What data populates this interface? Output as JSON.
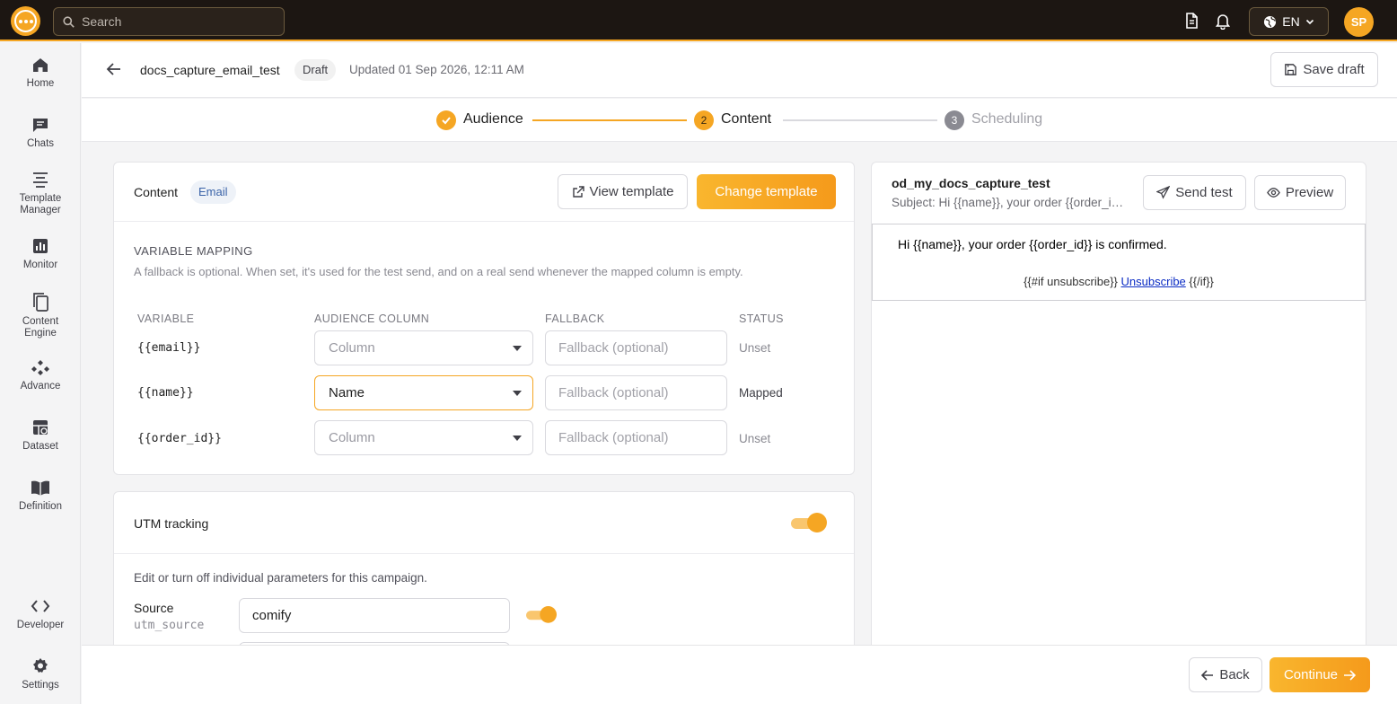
{
  "topbar": {
    "search_placeholder": "Search",
    "lang": "EN",
    "avatar_initials": "SP"
  },
  "sidebar": {
    "items": [
      {
        "label": "Home",
        "icon": "home-icon"
      },
      {
        "label": "Chats",
        "icon": "chat-icon"
      },
      {
        "label": "Template Manager",
        "icon": "template-icon"
      },
      {
        "label": "Monitor",
        "icon": "monitor-icon"
      },
      {
        "label": "Content Engine",
        "icon": "content-engine-icon"
      },
      {
        "label": "Advance",
        "icon": "advance-icon"
      },
      {
        "label": "Dataset",
        "icon": "dataset-icon"
      },
      {
        "label": "Definition",
        "icon": "definition-icon"
      },
      {
        "label": "Developer",
        "icon": "code-icon"
      },
      {
        "label": "Settings",
        "icon": "gear-icon"
      }
    ]
  },
  "header": {
    "campaign_name": "docs_capture_email_test",
    "badge": "Draft",
    "updated": "Updated 01 Sep 2026, 12:11 AM",
    "save_draft": "Save draft"
  },
  "stepper": {
    "steps": [
      {
        "num": "",
        "label": "Audience",
        "state": "done"
      },
      {
        "num": "2",
        "label": "Content",
        "state": "active"
      },
      {
        "num": "3",
        "label": "Scheduling",
        "state": "pending"
      }
    ]
  },
  "content_card": {
    "title": "Content",
    "badge": "Email",
    "view_template": "View template",
    "change_template": "Change template",
    "mapping_title": "VARIABLE MAPPING",
    "mapping_desc": "A fallback is optional. When set, it's used for the test send, and on a real send whenever the mapped column is empty.",
    "columns": {
      "variable": "VARIABLE",
      "audience_column": "AUDIENCE COLUMN",
      "fallback": "FALLBACK",
      "status": "STATUS"
    },
    "rows": [
      {
        "variable": "{{email}}",
        "column": "Column",
        "column_selected": false,
        "fallback_placeholder": "Fallback (optional)",
        "status": "Unset"
      },
      {
        "variable": "{{name}}",
        "column": "Name",
        "column_selected": true,
        "fallback_placeholder": "Fallback (optional)",
        "status": "Mapped"
      },
      {
        "variable": "{{order_id}}",
        "column": "Column",
        "column_selected": false,
        "fallback_placeholder": "Fallback (optional)",
        "status": "Unset"
      }
    ]
  },
  "utm_card": {
    "title": "UTM tracking",
    "enabled": true,
    "desc": "Edit or turn off individual parameters for this campaign.",
    "source_label": "Source",
    "source_key": "utm_source",
    "source_value": "comify",
    "source_enabled": true
  },
  "preview": {
    "template_name": "od_my_docs_capture_test",
    "subject": "Subject: Hi {{name}}, your order {{order_id}} is confirmed.",
    "send_test": "Send test",
    "preview": "Preview",
    "body_text": "Hi {{name}}, your order {{order_id}} is confirmed.",
    "footer_prefix": "{{#if unsubscribe}}",
    "footer_link": "Unsubscribe",
    "footer_suffix": "{{/if}}"
  },
  "footer": {
    "back": "Back",
    "continue": "Continue"
  },
  "colors": {
    "accent": "#f5a623",
    "topbar": "#1c1612",
    "mapped": "#3f3f46",
    "unset": "#8a8a92"
  }
}
